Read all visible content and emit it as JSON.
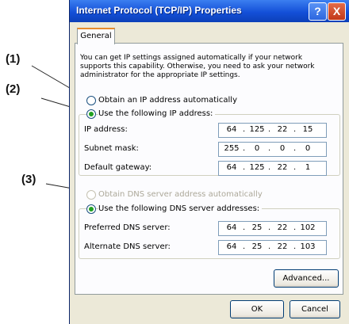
{
  "callouts": [
    "(1)",
    "(2)",
    "(3)"
  ],
  "window": {
    "title": "Internet Protocol (TCP/IP) Properties",
    "help_glyph": "?",
    "close_glyph": "X",
    "tab": "General",
    "intro": "You can get IP settings assigned automatically if your network supports this capability. Otherwise, you need to ask your network administrator for the appropriate IP settings.",
    "ip_auto_label": "Obtain an IP address automatically",
    "ip_manual_label": "Use the following IP address:",
    "ip_mode": "manual",
    "ip_fields": [
      {
        "label": "IP address:",
        "octets": [
          "64",
          "125",
          "22",
          "15"
        ]
      },
      {
        "label": "Subnet mask:",
        "octets": [
          "255",
          "0",
          "0",
          "0"
        ]
      },
      {
        "label": "Default gateway:",
        "octets": [
          "64",
          "125",
          "22",
          "1"
        ]
      }
    ],
    "dns_auto_label": "Obtain DNS server address automatically",
    "dns_auto_disabled": true,
    "dns_manual_label": "Use the following DNS server addresses:",
    "dns_fields": [
      {
        "label": "Preferred DNS server:",
        "octets": [
          "64",
          "25",
          "22",
          "102"
        ]
      },
      {
        "label": "Alternate DNS server:",
        "octets": [
          "64",
          "25",
          "22",
          "103"
        ]
      }
    ],
    "advanced_button": "Advanced...",
    "ok_button": "OK",
    "cancel_button": "Cancel"
  },
  "colors": {
    "title_bar": "#1450d8",
    "dialog_face": "#ece9d8",
    "radio_selected": "#21a121",
    "disabled_text": "#aca899"
  },
  "icons": {
    "leader_lines": "callout-leader-lines"
  }
}
